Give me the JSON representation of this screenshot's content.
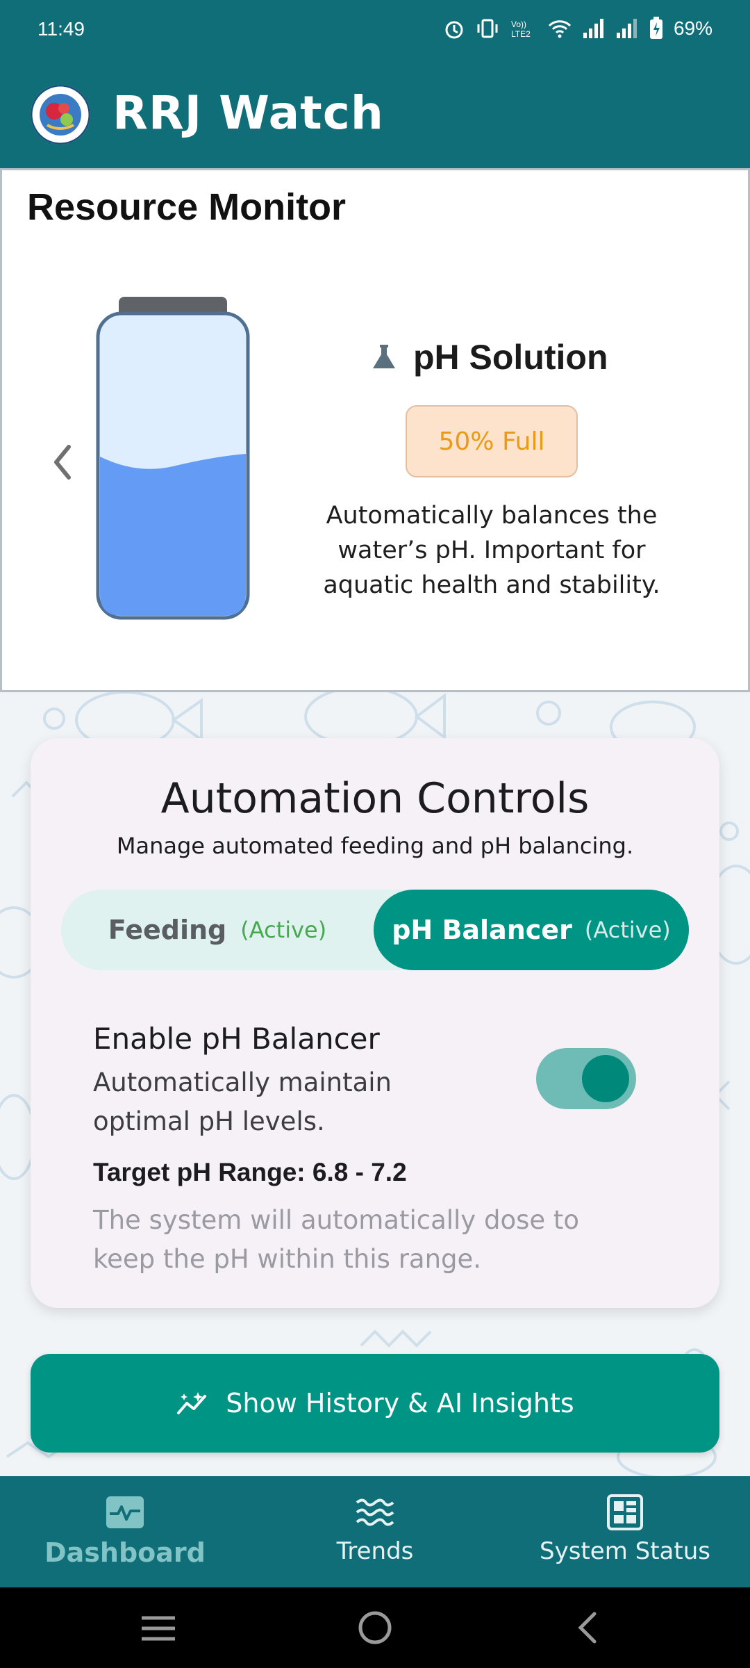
{
  "status_bar": {
    "time": "11:49",
    "battery": "69%"
  },
  "app": {
    "title": "RRJ Watch"
  },
  "resource_monitor": {
    "title": "Resource Monitor",
    "item_name": "pH Solution",
    "fill_label": "50% Full",
    "fill_level": 0.5,
    "description": "Automatically balances the water’s pH. Important for aquatic health and stability."
  },
  "automation": {
    "title": "Automation Controls",
    "subtitle": "Manage automated feeding and pH balancing.",
    "tabs": [
      {
        "label": "Feeding",
        "status": "(Active)",
        "selected": false
      },
      {
        "label": "pH Balancer",
        "status": "(Active)",
        "selected": true
      }
    ],
    "enable": {
      "title": "Enable pH Balancer",
      "description": "Automatically maintain optimal pH levels.",
      "toggle_on": true
    },
    "target_range": "Target pH Range: 6.8 - 7.2",
    "target_description": "The system will automatically dose to keep the pH within this range."
  },
  "actions": {
    "history_button": "Show History & AI Insights"
  },
  "bottom_nav": {
    "items": [
      {
        "label": "Dashboard",
        "icon": "dashboard-icon",
        "active": true
      },
      {
        "label": "Trends",
        "icon": "waves-icon",
        "active": false
      },
      {
        "label": "System Status",
        "icon": "system-status-icon",
        "active": false
      }
    ]
  },
  "colors": {
    "primary": "#0f6e78",
    "accent": "#009485",
    "badge_text": "#e99a17",
    "active_status": "#47a84f"
  }
}
